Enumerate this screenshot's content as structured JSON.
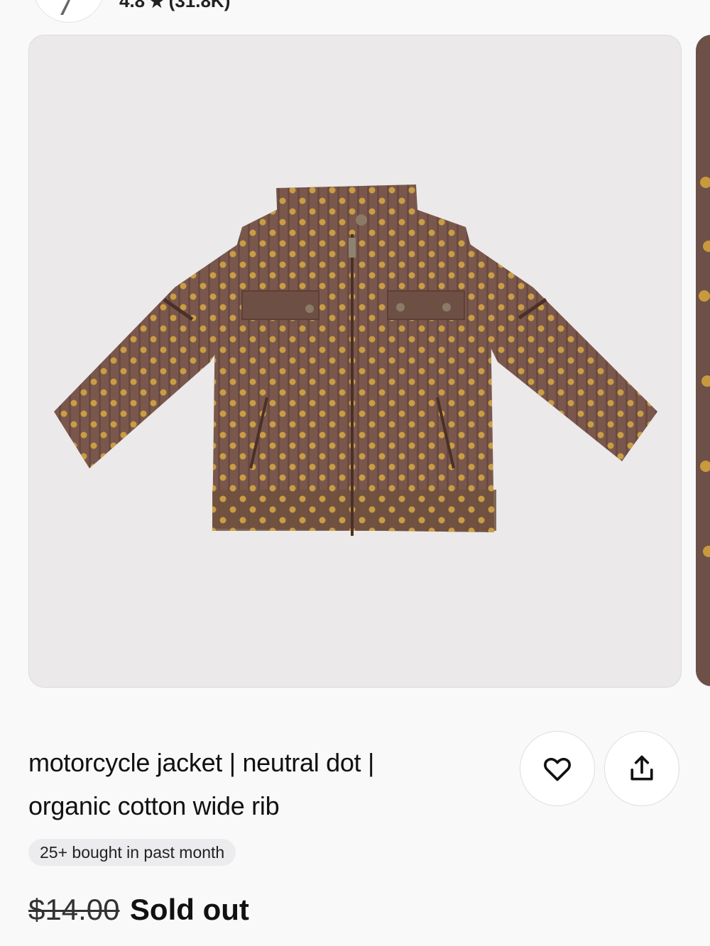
{
  "store": {
    "rating": "4.8",
    "reviews": "(31.8K)"
  },
  "icons": {
    "star": "star-icon",
    "favorite": "heart-icon",
    "share": "share-icon"
  },
  "product": {
    "title_line1": "motorcycle jacket | neutral dot |",
    "title_line2": "organic cotton wide rib",
    "badge": "25+ bought in past month",
    "original_price": "$14.00",
    "status": "Sold out"
  },
  "colors": {
    "jacket": "#7a574c",
    "dots": "#c99d44",
    "background": "#ebe9e9"
  }
}
